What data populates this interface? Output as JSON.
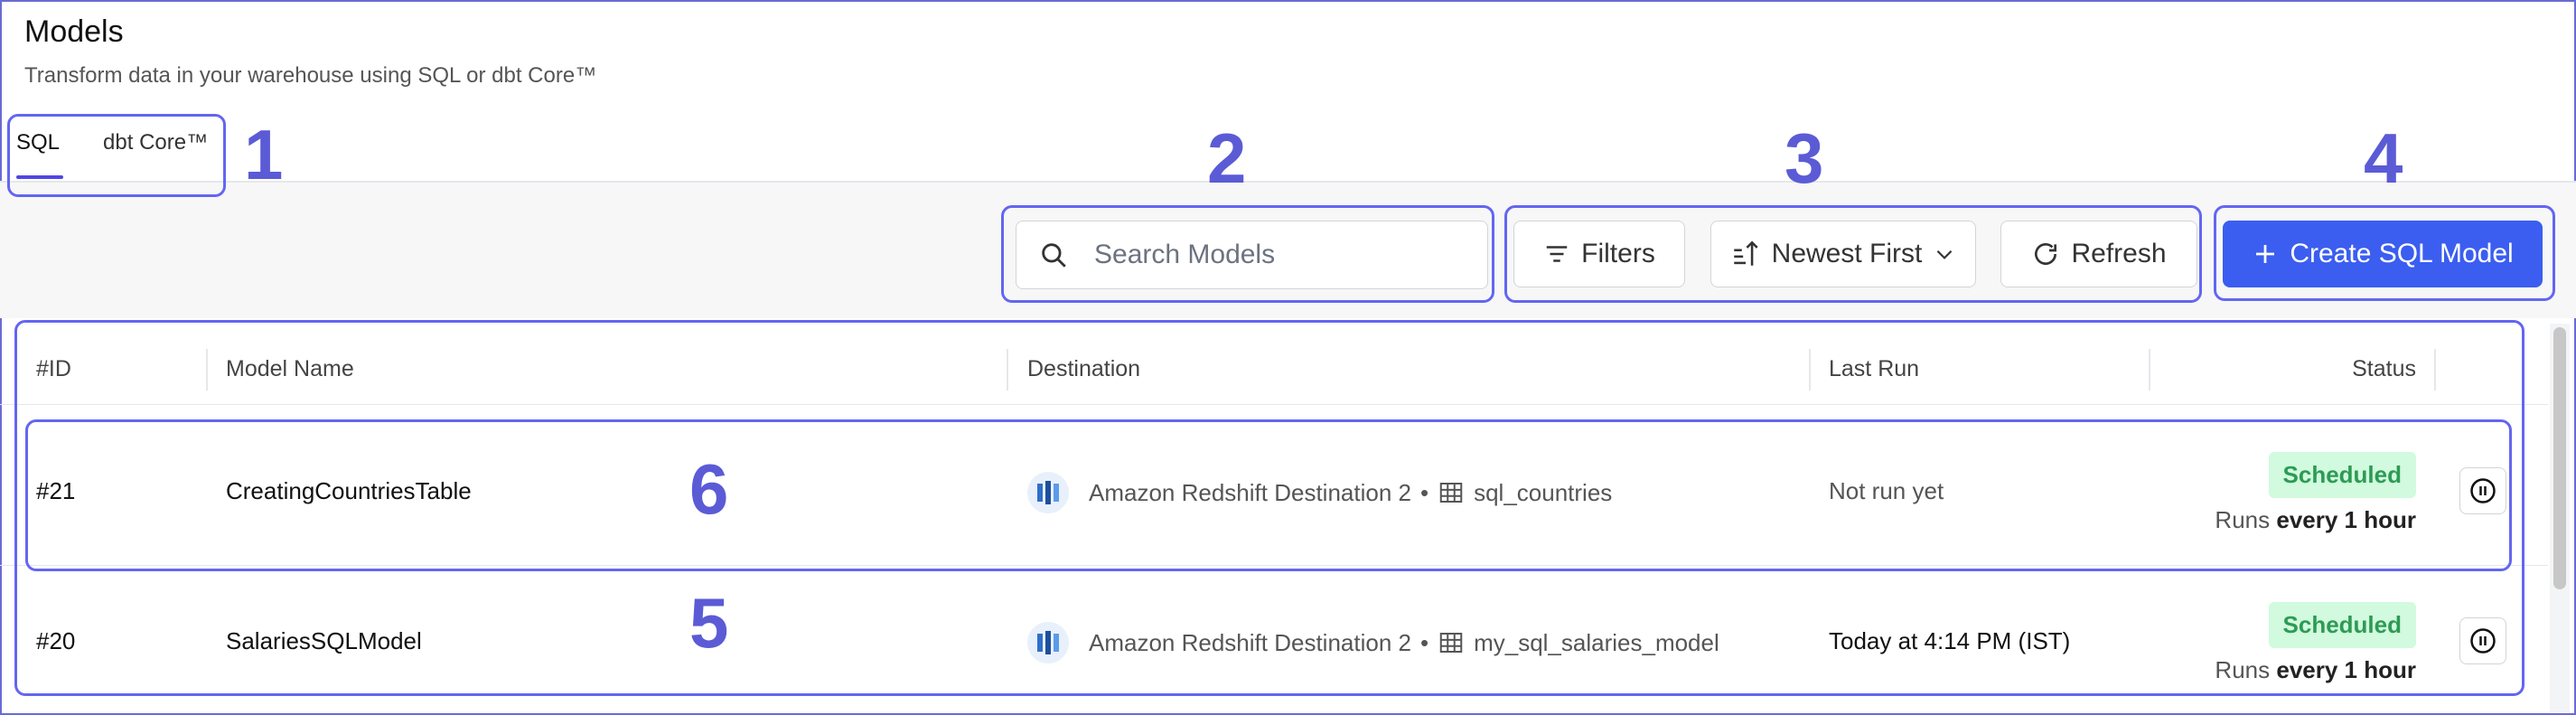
{
  "header": {
    "title": "Models",
    "subtitle": "Transform data in your warehouse using SQL or dbt Core™"
  },
  "tabs": [
    {
      "label": "SQL",
      "active": true
    },
    {
      "label": "dbt Core™",
      "active": false
    }
  ],
  "toolbar": {
    "search_placeholder": "Search Models",
    "filters_label": "Filters",
    "sort_label": "Newest First",
    "refresh_label": "Refresh",
    "create_label": "Create SQL Model"
  },
  "table": {
    "columns": [
      "#ID",
      "Model Name",
      "Destination",
      "Last Run",
      "Status"
    ],
    "rows": [
      {
        "id": "#21",
        "name": "CreatingCountriesTable",
        "destination": "Amazon Redshift Destination 2",
        "separator": "•",
        "table_name": "sql_countries",
        "last_run": "Not run yet",
        "status": "Scheduled",
        "runs_prefix": "Runs",
        "runs_freq": "every 1 hour"
      },
      {
        "id": "#20",
        "name": "SalariesSQLModel",
        "destination": "Amazon Redshift Destination 2",
        "separator": "•",
        "table_name": "my_sql_salaries_model",
        "last_run": "Today at 4:14 PM (IST)",
        "status": "Scheduled",
        "runs_prefix": "Runs",
        "runs_freq": "every 1 hour"
      }
    ]
  },
  "annotations": [
    "1",
    "2",
    "3",
    "4",
    "5",
    "6"
  ],
  "colors": {
    "accent": "#3b5ef0",
    "annotation": "#6366f1",
    "status_bg": "#d1fadf",
    "status_text": "#2e9b54"
  }
}
